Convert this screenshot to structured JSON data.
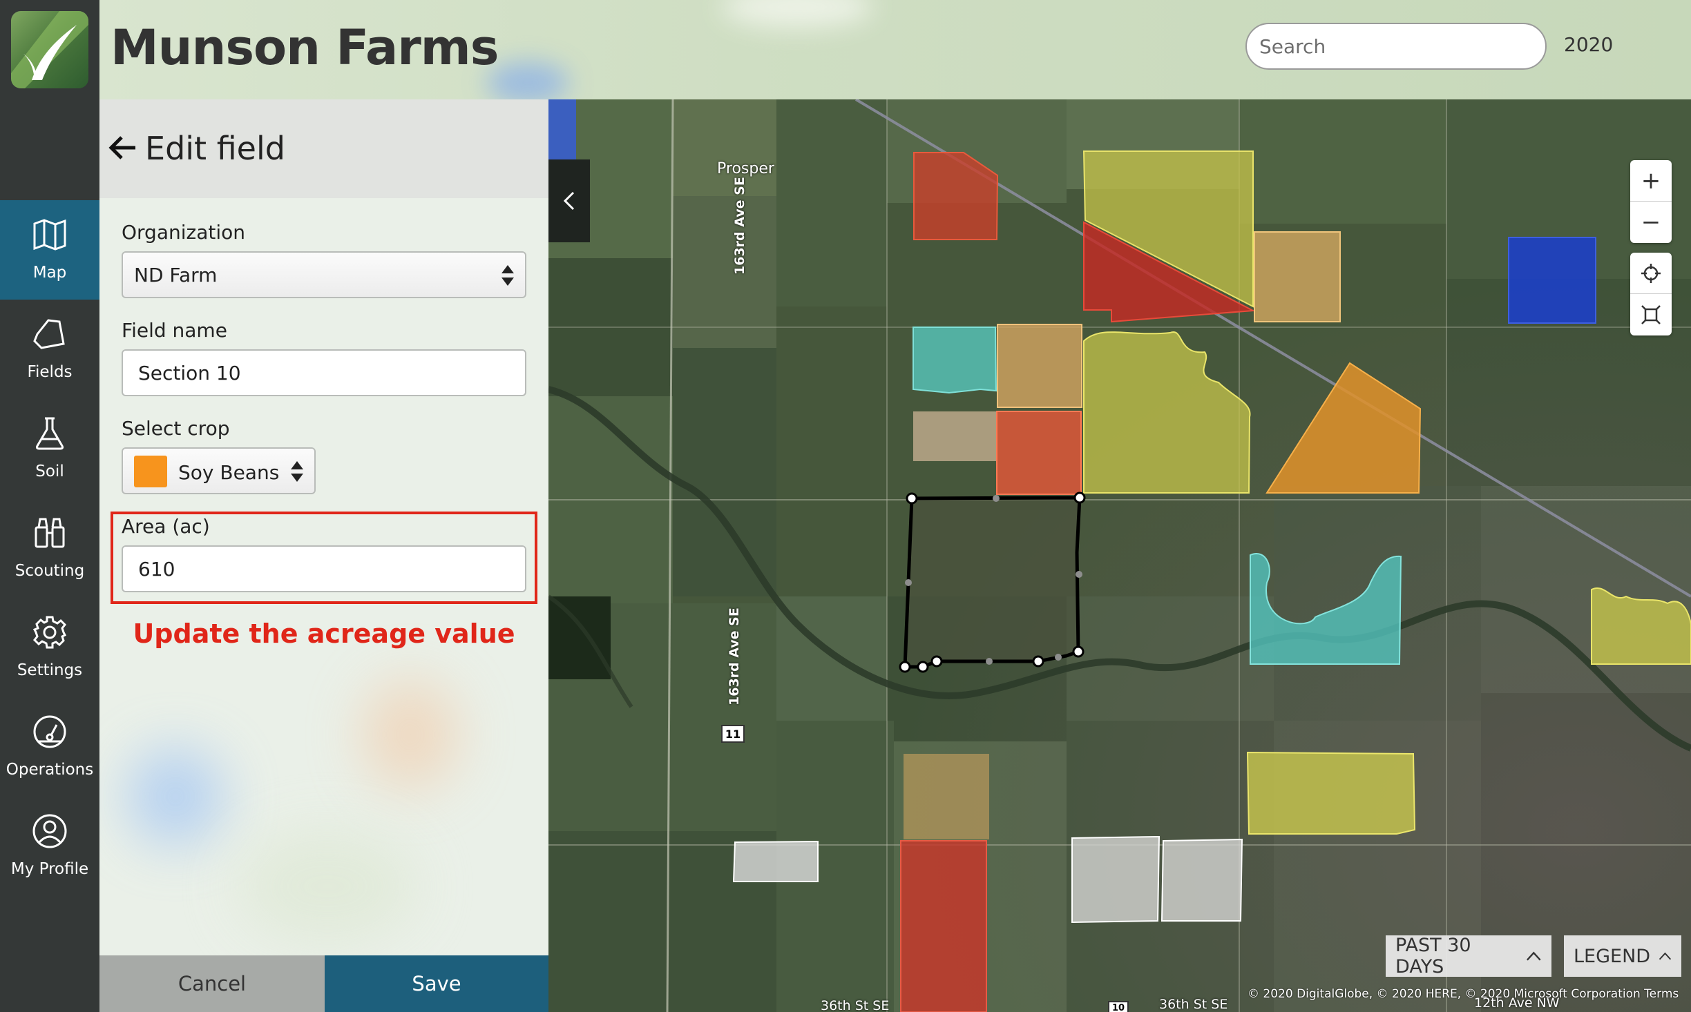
{
  "app": {
    "title": "Munson Farms",
    "search_placeholder": "Search",
    "year": "2020"
  },
  "nav": {
    "items": [
      {
        "label": "Map",
        "icon": "map-icon",
        "active": true
      },
      {
        "label": "Fields",
        "icon": "fields-icon"
      },
      {
        "label": "Soil",
        "icon": "flask-icon"
      },
      {
        "label": "Scouting",
        "icon": "binoculars-icon"
      },
      {
        "label": "Settings",
        "icon": "gear-icon"
      },
      {
        "label": "Operations",
        "icon": "gauge-icon"
      },
      {
        "label": "My Profile",
        "icon": "user-icon"
      }
    ]
  },
  "panel": {
    "title": "Edit field",
    "organization": {
      "label": "Organization",
      "value": "ND Farm"
    },
    "field_name": {
      "label": "Field name",
      "value": "Section 10"
    },
    "crop": {
      "label": "Select crop",
      "value": "Soy Beans",
      "color": "#f7941d"
    },
    "area": {
      "label": "Area (ac)",
      "value": "610"
    },
    "instruction": "Update the acreage value",
    "cancel_label": "Cancel",
    "save_label": "Save"
  },
  "map": {
    "town_label": "Prosper",
    "road_label_1": "163rd Ave SE",
    "road_label_2": "163rd Ave SE",
    "highway_shield": "11",
    "street_label_1": "36th St SE",
    "street_label_2": "36th St SE",
    "street_label_3": "12th Ave NW",
    "highway_shield_2": "10",
    "past_button": "PAST 30 DAYS",
    "legend_button": "LEGEND",
    "attribution": "© 2020 DigitalGlobe, © 2020 HERE, © 2020 Microsoft Corporation  Terms",
    "zoom_in": "+",
    "zoom_out": "−"
  },
  "colors": {
    "accent": "#1d6380",
    "save": "#1d5f7c",
    "highlight": "#e02619"
  }
}
